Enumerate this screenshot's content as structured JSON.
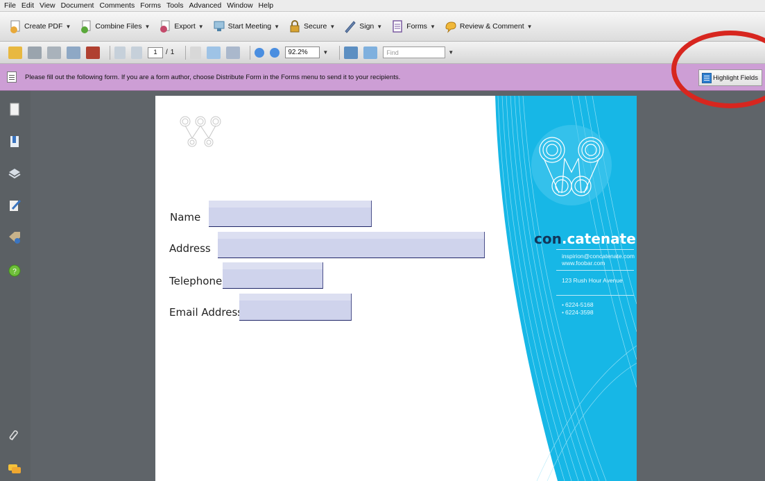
{
  "menu": [
    "File",
    "Edit",
    "View",
    "Document",
    "Comments",
    "Forms",
    "Tools",
    "Advanced",
    "Window",
    "Help"
  ],
  "toolbar1": [
    {
      "label": "Create PDF",
      "icon": "create-pdf-icon",
      "color": "#e8a93a"
    },
    {
      "label": "Combine Files",
      "icon": "combine-files-icon",
      "color": "#5aa83a"
    },
    {
      "label": "Export",
      "icon": "export-icon",
      "color": "#c44a6b"
    },
    {
      "label": "Start Meeting",
      "icon": "start-meeting-icon",
      "color": "#4d82a8"
    },
    {
      "label": "Secure",
      "icon": "lock-icon",
      "color": "#c8952c"
    },
    {
      "label": "Sign",
      "icon": "pen-icon",
      "color": "#6b86b0"
    },
    {
      "label": "Forms",
      "icon": "forms-icon",
      "color": "#7a5aa0"
    },
    {
      "label": "Review & Comment",
      "icon": "review-icon",
      "color": "#e8a02a"
    }
  ],
  "toolbar2": {
    "page_current": "1",
    "page_sep": "/",
    "page_total": "1",
    "zoom": "92.2%",
    "find_placeholder": "Find"
  },
  "formbar": {
    "message": "Please fill out the following form. If you are a form author, choose Distribute Form in the Forms menu to send it to your recipients.",
    "highlight_label": "Highlight Fields"
  },
  "form": {
    "fields": [
      {
        "label": "Name"
      },
      {
        "label": "Address"
      },
      {
        "label": "Telephone"
      },
      {
        "label": "Email Address"
      }
    ]
  },
  "brand": {
    "part1": "con",
    "part2": ".catenate",
    "email": "inspirion@concatenate.com",
    "web": "www.foobar.com",
    "street": "123 Rush Hour Avenue",
    "phone1": "6224-5168",
    "phone2": "6224-3598"
  },
  "colors": {
    "formbar": "#cd9ed5",
    "field_fill": "#cfd3ec",
    "brand_panel": "#17b7e6",
    "annotation": "#d7261f"
  }
}
